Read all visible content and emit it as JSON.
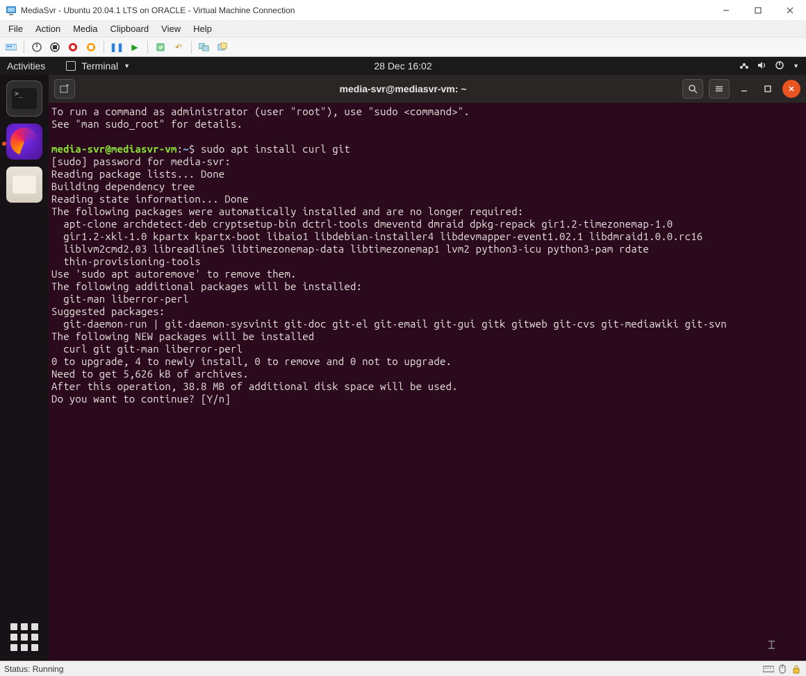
{
  "window": {
    "title": "MediaSvr - Ubuntu 20.04.1 LTS on ORACLE - Virtual Machine Connection",
    "menubar": [
      "File",
      "Action",
      "Media",
      "Clipboard",
      "View",
      "Help"
    ],
    "status": "Status: Running"
  },
  "gnome": {
    "activities": "Activities",
    "terminal_label": "Terminal",
    "datetime": "28 Dec  16:02"
  },
  "terminal": {
    "title": "media-svr@mediasvr-vm: ~",
    "prompt_user": "media-svr@mediasvr-vm",
    "prompt_path": "~",
    "command": "sudo apt install curl git",
    "lines_pre": [
      "To run a command as administrator (user \"root\"), use \"sudo <command>\".",
      "See \"man sudo_root\" for details.",
      ""
    ],
    "lines_post": [
      "[sudo] password for media-svr:",
      "Reading package lists... Done",
      "Building dependency tree",
      "Reading state information... Done",
      "The following packages were automatically installed and are no longer required:",
      "  apt-clone archdetect-deb cryptsetup-bin dctrl-tools dmeventd dmraid dpkg-repack gir1.2-timezonemap-1.0",
      "  gir1.2-xkl-1.0 kpartx kpartx-boot libaio1 libdebian-installer4 libdevmapper-event1.02.1 libdmraid1.0.0.rc16",
      "  liblvm2cmd2.03 libreadline5 libtimezonemap-data libtimezonemap1 lvm2 python3-icu python3-pam rdate",
      "  thin-provisioning-tools",
      "Use 'sudo apt autoremove' to remove them.",
      "The following additional packages will be installed:",
      "  git-man liberror-perl",
      "Suggested packages:",
      "  git-daemon-run | git-daemon-sysvinit git-doc git-el git-email git-gui gitk gitweb git-cvs git-mediawiki git-svn",
      "The following NEW packages will be installed",
      "  curl git git-man liberror-perl",
      "0 to upgrade, 4 to newly install, 0 to remove and 0 not to upgrade.",
      "Need to get 5,626 kB of archives.",
      "After this operation, 38.8 MB of additional disk space will be used.",
      "Do you want to continue? [Y/n] "
    ]
  }
}
